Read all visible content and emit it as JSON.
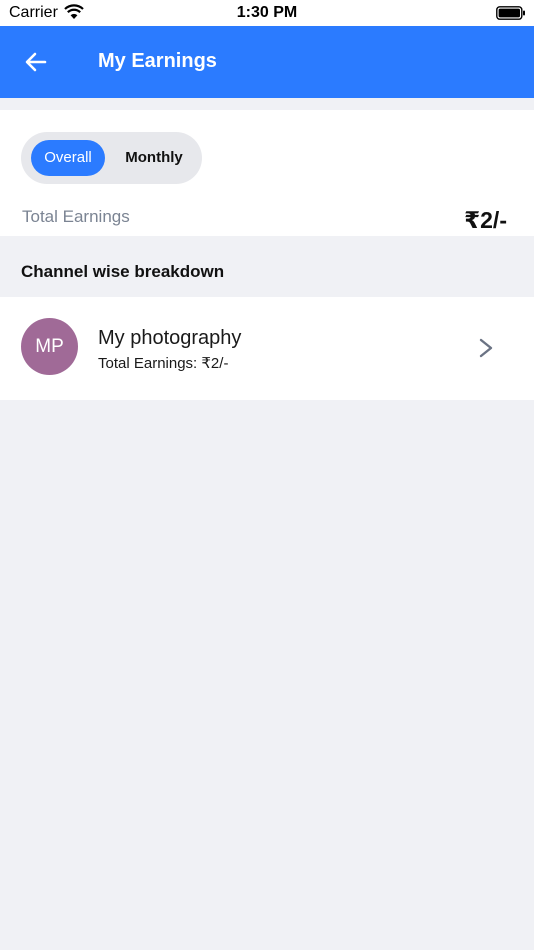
{
  "status_bar": {
    "carrier": "Carrier",
    "time": "1:30 PM"
  },
  "app_bar": {
    "title": "My Earnings",
    "back_icon": "arrow-left-icon"
  },
  "summary": {
    "tabs": [
      {
        "label": "Overall",
        "selected": true
      },
      {
        "label": "Monthly",
        "selected": false
      }
    ],
    "total_label": "Total Earnings",
    "total_value": "₹2/-"
  },
  "breakdown": {
    "header": "Channel wise breakdown",
    "channels": [
      {
        "initials": "MP",
        "name": "My photography",
        "earnings": "Total Earnings: ₹2/-",
        "avatar_color": "#a06a97"
      }
    ]
  },
  "colors": {
    "accent": "#2b7bff",
    "background": "#f0f1f5"
  }
}
